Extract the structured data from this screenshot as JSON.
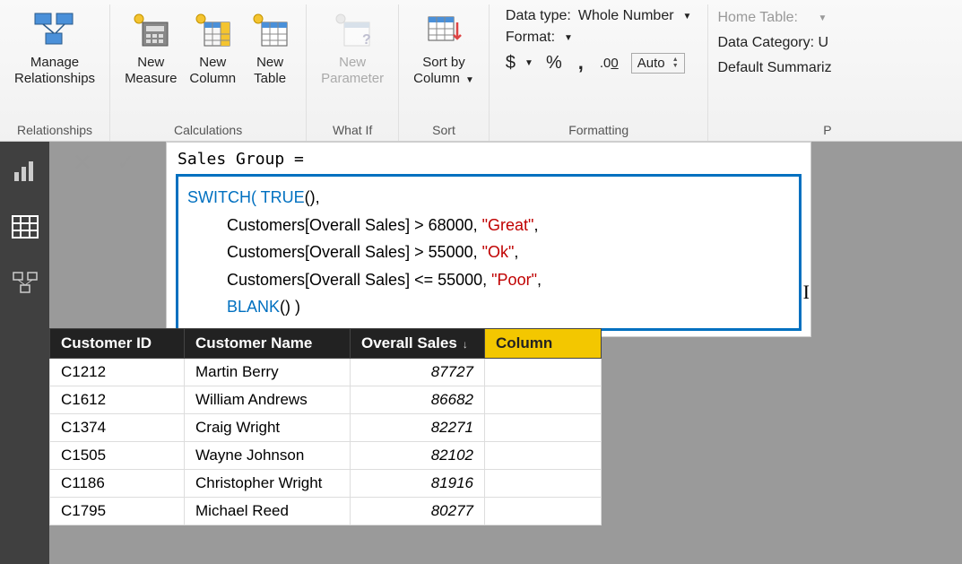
{
  "ribbon": {
    "manage_relationships": {
      "label1": "Manage",
      "label2": "Relationships"
    },
    "new_measure": {
      "label1": "New",
      "label2": "Measure"
    },
    "new_column": {
      "label1": "New",
      "label2": "Column"
    },
    "new_table": {
      "label1": "New",
      "label2": "Table"
    },
    "new_parameter": {
      "label1": "New",
      "label2": "Parameter"
    },
    "sort_by_column": {
      "label1": "Sort by",
      "label2": "Column"
    },
    "groups": {
      "relationships": "Relationships",
      "calculations": "Calculations",
      "whatif": "What If",
      "sort": "Sort",
      "formatting": "Formatting",
      "properties": "P"
    }
  },
  "formatting": {
    "data_type_label": "Data type:",
    "data_type_value": "Whole Number",
    "format_label": "Format:",
    "currency_symbol": "$",
    "percent_symbol": "%",
    "comma_symbol": ",",
    "decimals_symbol": ".00",
    "auto_value": "Auto"
  },
  "properties": {
    "home_table": "Home Table:",
    "data_category": "Data Category: U",
    "default_summarize": "Default Summariz"
  },
  "formula": {
    "measure_name": "Sales Group =",
    "line1_kw": "SWITCH(",
    "line1_rest": " ",
    "line1_true": "TRUE",
    "line1_end": "(),",
    "line2": "Customers[Overall Sales] > 68000, ",
    "line2_str": "\"Great\"",
    "line2_end": ",",
    "line3": "Customers[Overall Sales] > 55000, ",
    "line3_str": "\"Ok\"",
    "line3_end": ",",
    "line4": "Customers[Overall Sales] <= 55000, ",
    "line4_str": "\"Poor\"",
    "line4_end": ",",
    "line5_kw": "BLANK",
    "line5_end": "() )"
  },
  "table": {
    "headers": {
      "id": "Customer ID",
      "name": "Customer Name",
      "sales": "Overall Sales",
      "column": "Column"
    },
    "rows": [
      {
        "id": "C1212",
        "name": "Martin Berry",
        "sales": "87727"
      },
      {
        "id": "C1612",
        "name": "William Andrews",
        "sales": "86682"
      },
      {
        "id": "C1374",
        "name": "Craig Wright",
        "sales": "82271"
      },
      {
        "id": "C1505",
        "name": "Wayne Johnson",
        "sales": "82102"
      },
      {
        "id": "C1186",
        "name": "Christopher Wright",
        "sales": "81916"
      },
      {
        "id": "C1795",
        "name": "Michael Reed",
        "sales": "80277"
      }
    ]
  }
}
